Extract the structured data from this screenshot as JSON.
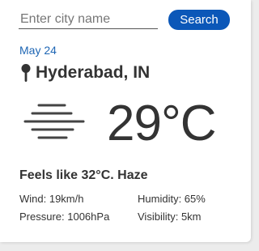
{
  "search": {
    "placeholder": "Enter city name",
    "value": "",
    "button_label": "Search"
  },
  "weather": {
    "date": "May 24",
    "location": "Hyderabad, IN",
    "icon": "haze-icon",
    "temperature": "29°C",
    "summary": "Feels like 32°C. Haze",
    "wind": "Wind: 19km/h",
    "humidity": "Humidity: 65%",
    "pressure": "Pressure: 1006hPa",
    "visibility": "Visibility: 5km"
  },
  "colors": {
    "accent": "#0b57b8",
    "date_text": "#1e66b4",
    "text": "#333333",
    "background": "#ececec",
    "card": "#ffffff"
  }
}
